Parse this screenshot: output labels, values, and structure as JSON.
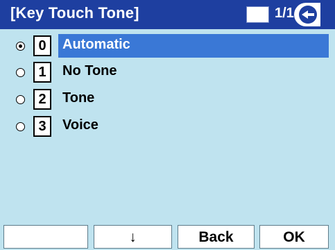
{
  "header": {
    "title": "[Key Touch Tone]",
    "page": "1/1",
    "back_icon": "back-arrow-icon"
  },
  "options": [
    {
      "key": "0",
      "label": "Automatic",
      "selected": true
    },
    {
      "key": "1",
      "label": "No Tone",
      "selected": false
    },
    {
      "key": "2",
      "label": "Tone",
      "selected": false
    },
    {
      "key": "3",
      "label": "Voice",
      "selected": false
    }
  ],
  "softkeys": {
    "key1": "",
    "key2": "↓",
    "key3": "Back",
    "key4": "OK"
  },
  "colors": {
    "header": "#1e3fa0",
    "background": "#bfe3ef",
    "selection": "#3a78d6"
  }
}
